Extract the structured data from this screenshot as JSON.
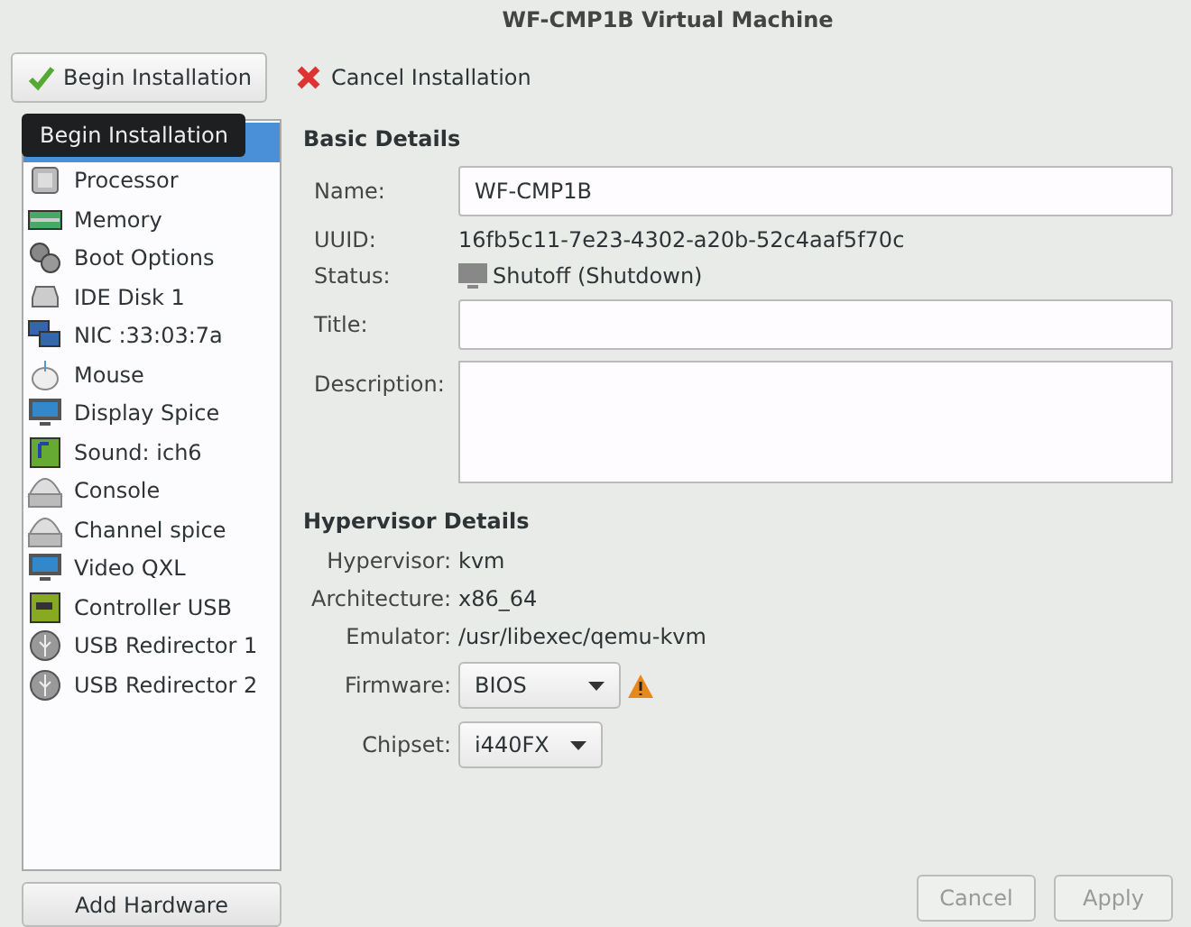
{
  "window": {
    "title": "WF-CMP1B Virtual Machine"
  },
  "toolbar": [
    {
      "label": "Begin Installation",
      "kind": "begin"
    },
    {
      "label": "Cancel Installation",
      "kind": "cancel"
    }
  ],
  "tooltip": "Begin Installation",
  "sidebar": {
    "items": [
      {
        "selected": true
      },
      {
        "label": "Processor",
        "selected": false
      },
      {
        "label": "Memory",
        "selected": false
      },
      {
        "label": "Boot Options",
        "selected": false
      },
      {
        "label": "IDE Disk 1",
        "selected": false
      },
      {
        "label": "NIC :33:03:7a",
        "selected": false
      },
      {
        "label": "Mouse",
        "selected": false
      },
      {
        "label": "Display Spice",
        "selected": false
      },
      {
        "label": "Sound: ich6",
        "selected": false
      },
      {
        "label": "Console",
        "selected": false
      },
      {
        "label": "Channel spice",
        "selected": false
      },
      {
        "label": "Video QXL",
        "selected": false
      },
      {
        "label": "Controller USB",
        "selected": false
      },
      {
        "label": "USB Redirector 1",
        "selected": false
      },
      {
        "label": "USB Redirector 2",
        "selected": false
      }
    ],
    "add_button": "Add Hardware"
  },
  "basic_details": {
    "heading": "Basic Details",
    "name": {
      "label": "Name:",
      "value": "WF-CMP1B"
    },
    "uuid": {
      "label": "UUID:",
      "value": "16fb5c11-7e23-4302-a20b-52c4aaf5f70c"
    },
    "status": {
      "label": "Status:",
      "value": "Shutoff (Shutdown)"
    },
    "title": {
      "label": "Title:"
    },
    "description": {
      "label": "Description:"
    }
  },
  "hypervisor_details": {
    "heading": "Hypervisor Details",
    "rows": [
      {
        "label": "Hypervisor:",
        "value": "kvm"
      },
      {
        "label": "Architecture:",
        "value": "x86_64"
      },
      {
        "label": "Emulator:",
        "value": "/usr/libexec/qemu-kvm"
      }
    ],
    "firmware": {
      "label": "Firmware:",
      "value": "BIOS"
    },
    "chipset": {
      "label": "Chipset:",
      "value": "i440FX"
    }
  },
  "buttons": [
    {
      "label": "Cancel",
      "disabled": true
    },
    {
      "label": "Apply",
      "disabled": true
    }
  ]
}
